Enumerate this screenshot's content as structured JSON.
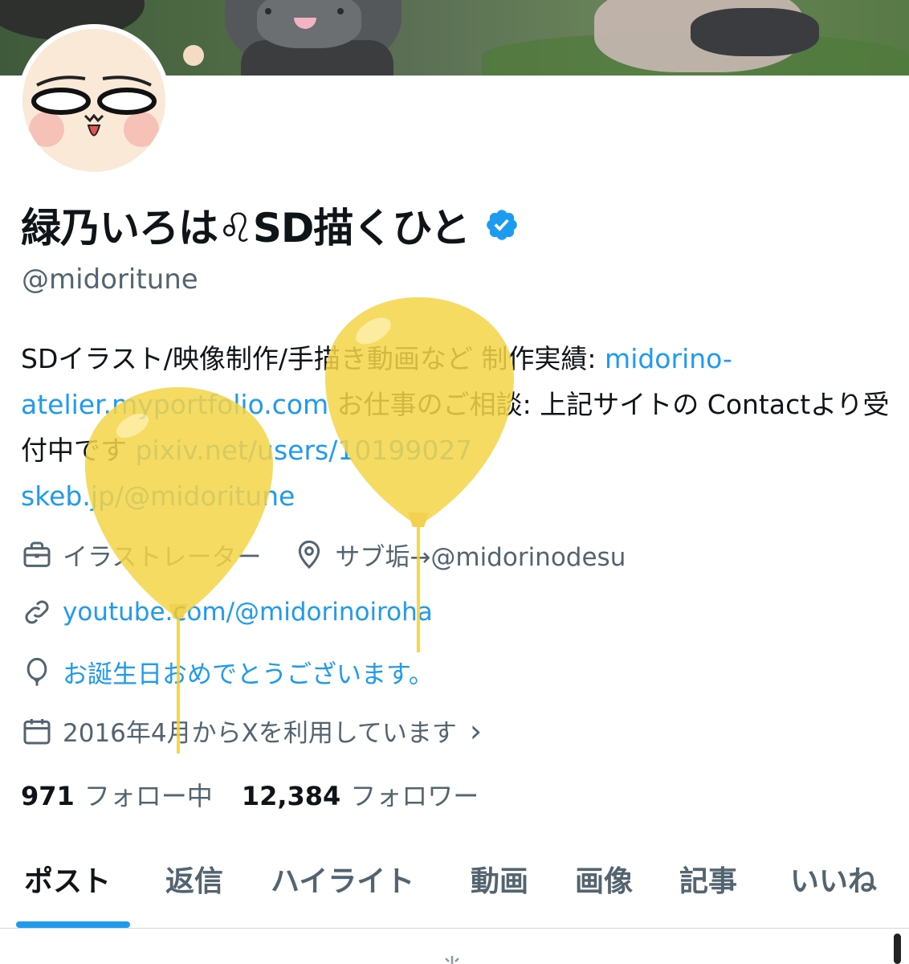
{
  "profile": {
    "display_name": "緑乃いろは♌SD描くひと",
    "handle": "@midoritune",
    "verified": true
  },
  "bio": {
    "text1": "SDイラスト/映像制作/手描き動画など 制作実績: ",
    "link1": "midorino-atelier.myportfolio.com",
    "text2": " お仕事のご相談: 上記サイトの Contactより受付中です ",
    "link2": "pixiv.net/users/10199027",
    "link3": "skeb.jp/@midoritune"
  },
  "meta": {
    "profession": "イラストレーター",
    "location": "サブ垢→@midorinodesu",
    "website": "youtube.com/@midorinoiroha",
    "birthday": "お誕生日おめでとうございます。",
    "joined": "2016年4月からXを利用しています",
    "chevron": "›"
  },
  "stats": {
    "following_count": "971",
    "following_label": "フォロー中",
    "followers_count": "12,384",
    "followers_label": "フォロワー"
  },
  "tabs": [
    "ポスト",
    "返信",
    "ハイライト",
    "動画",
    "画像",
    "記事",
    "いいね"
  ],
  "active_tab": 0,
  "colors": {
    "accent": "#1d9bf0",
    "text": "#0f1419",
    "muted": "#536471",
    "balloon": "#f5d548"
  },
  "icons": {
    "verified": "verified-badge-icon",
    "profession": "briefcase-icon",
    "location": "location-pin-icon",
    "website": "link-icon",
    "birthday": "balloon-icon",
    "joined": "calendar-icon"
  }
}
